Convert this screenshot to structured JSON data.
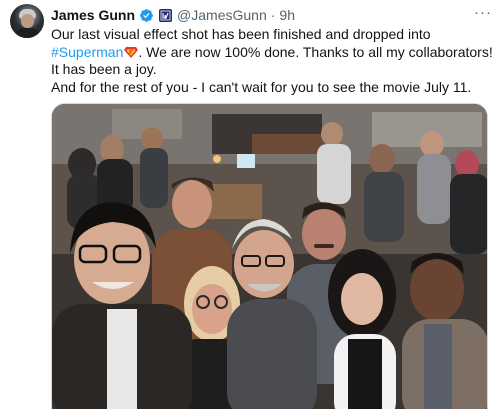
{
  "tweet": {
    "author_name": "James Gunn",
    "handle": "@JamesGunn",
    "separator": "·",
    "time": "9h",
    "more_label": "···",
    "text_line1": "Our last visual effect shot has been finished and dropped into",
    "hashtag": "#Superman",
    "text_line2_rest": ". We are now 100% done. Thanks to all my collaborators!",
    "text_line3": "It has been a joy.",
    "text_line4": "And for the rest of you - I can't wait for you to see the movie July 11."
  },
  "icons": {
    "avatar": "user-avatar",
    "verified": "verified-badge-icon",
    "affiliate": "affiliate-badge-icon",
    "more": "more-icon",
    "emoji": "superman-emoji-icon"
  },
  "colors": {
    "link": "#1d9bf0",
    "secondary_text": "#536471",
    "verified": "#1d9bf0"
  }
}
